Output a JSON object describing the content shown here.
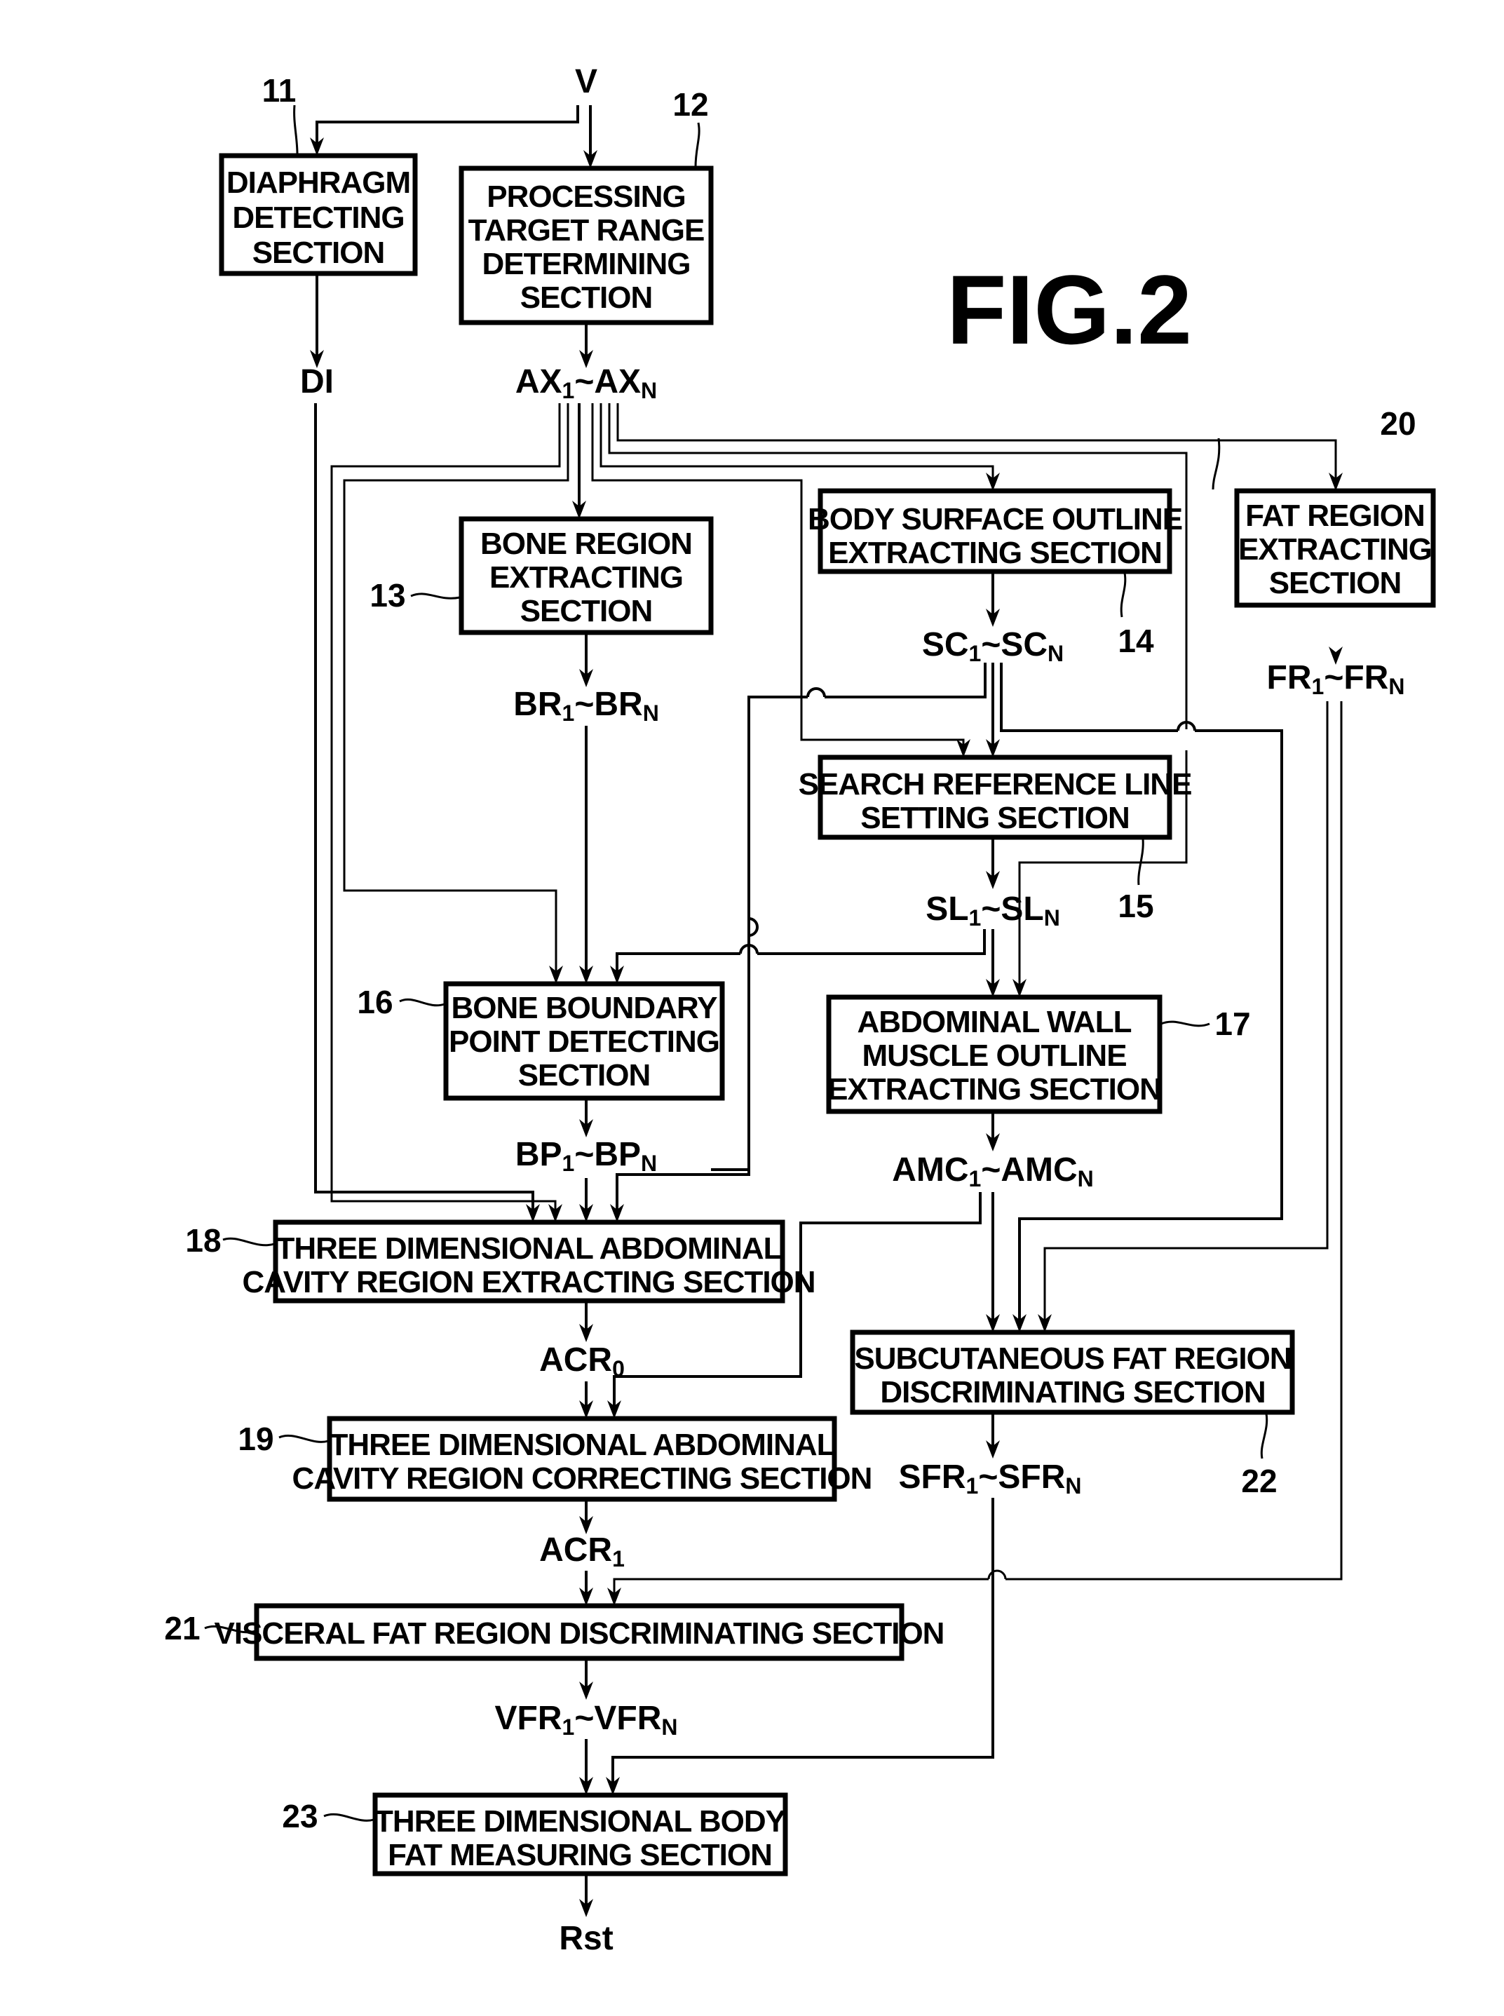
{
  "figure": {
    "title": "FIG.2"
  },
  "inputs": {
    "volume": "V"
  },
  "blocks": {
    "b11": {
      "ref": "11",
      "lines": [
        "DIAPHRAGM",
        "DETECTING",
        "SECTION"
      ]
    },
    "b12": {
      "ref": "12",
      "lines": [
        "PROCESSING",
        "TARGET RANGE",
        "DETERMINING",
        "SECTION"
      ]
    },
    "b13": {
      "ref": "13",
      "lines": [
        "BONE REGION",
        "EXTRACTING",
        "SECTION"
      ]
    },
    "b14": {
      "ref": "14",
      "lines": [
        "BODY SURFACE OUTLINE",
        "EXTRACTING SECTION"
      ]
    },
    "b15": {
      "ref": "15",
      "lines": [
        "SEARCH REFERENCE LINE",
        "SETTING SECTION"
      ]
    },
    "b16": {
      "ref": "16",
      "lines": [
        "BONE BOUNDARY",
        "POINT DETECTING",
        "SECTION"
      ]
    },
    "b17": {
      "ref": "17",
      "lines": [
        "ABDOMINAL WALL",
        "MUSCLE OUTLINE",
        "EXTRACTING SECTION"
      ]
    },
    "b18": {
      "ref": "18",
      "lines": [
        "THREE DIMENSIONAL ABDOMINAL",
        "CAVITY REGION EXTRACTING SECTION"
      ]
    },
    "b19": {
      "ref": "19",
      "lines": [
        "THREE DIMENSIONAL ABDOMINAL",
        "CAVITY REGION CORRECTING SECTION"
      ]
    },
    "b20": {
      "ref": "20",
      "lines": [
        "FAT REGION",
        "EXTRACTING",
        "SECTION"
      ]
    },
    "b21": {
      "ref": "21",
      "lines": [
        "VISCERAL FAT REGION DISCRIMINATING SECTION"
      ]
    },
    "b22": {
      "ref": "22",
      "lines": [
        "SUBCUTANEOUS FAT REGION",
        "DISCRIMINATING SECTION"
      ]
    },
    "b23": {
      "ref": "23",
      "lines": [
        "THREE DIMENSIONAL BODY",
        "FAT MEASURING SECTION"
      ]
    }
  },
  "signals": {
    "DI": {
      "base": "DI",
      "sub1": "",
      "tilde": "",
      "base2": "",
      "sub2": ""
    },
    "AX": {
      "base": "AX",
      "sub1": "1",
      "tilde": "~",
      "base2": "AX",
      "sub2": "N"
    },
    "BR": {
      "base": "BR",
      "sub1": "1",
      "tilde": "~",
      "base2": "BR",
      "sub2": "N"
    },
    "SC": {
      "base": "SC",
      "sub1": "1",
      "tilde": "~",
      "base2": "SC",
      "sub2": "N"
    },
    "FR": {
      "base": "FR",
      "sub1": "1",
      "tilde": "~",
      "base2": "FR",
      "sub2": "N"
    },
    "SL": {
      "base": "SL",
      "sub1": "1",
      "tilde": "~",
      "base2": "SL",
      "sub2": "N"
    },
    "BP": {
      "base": "BP",
      "sub1": "1",
      "tilde": "~",
      "base2": "BP",
      "sub2": "N"
    },
    "AMC": {
      "base": "AMC",
      "sub1": "1",
      "tilde": "~",
      "base2": "AMC",
      "sub2": "N"
    },
    "ACR0": {
      "base": "ACR",
      "sub1": "0"
    },
    "ACR1": {
      "base": "ACR",
      "sub1": "1"
    },
    "SFR": {
      "base": "SFR",
      "sub1": "1",
      "tilde": "~",
      "base2": "SFR",
      "sub2": "N"
    },
    "VFR": {
      "base": "VFR",
      "sub1": "1",
      "tilde": "~",
      "base2": "VFR",
      "sub2": "N"
    },
    "Rst": {
      "base": "Rst"
    }
  }
}
